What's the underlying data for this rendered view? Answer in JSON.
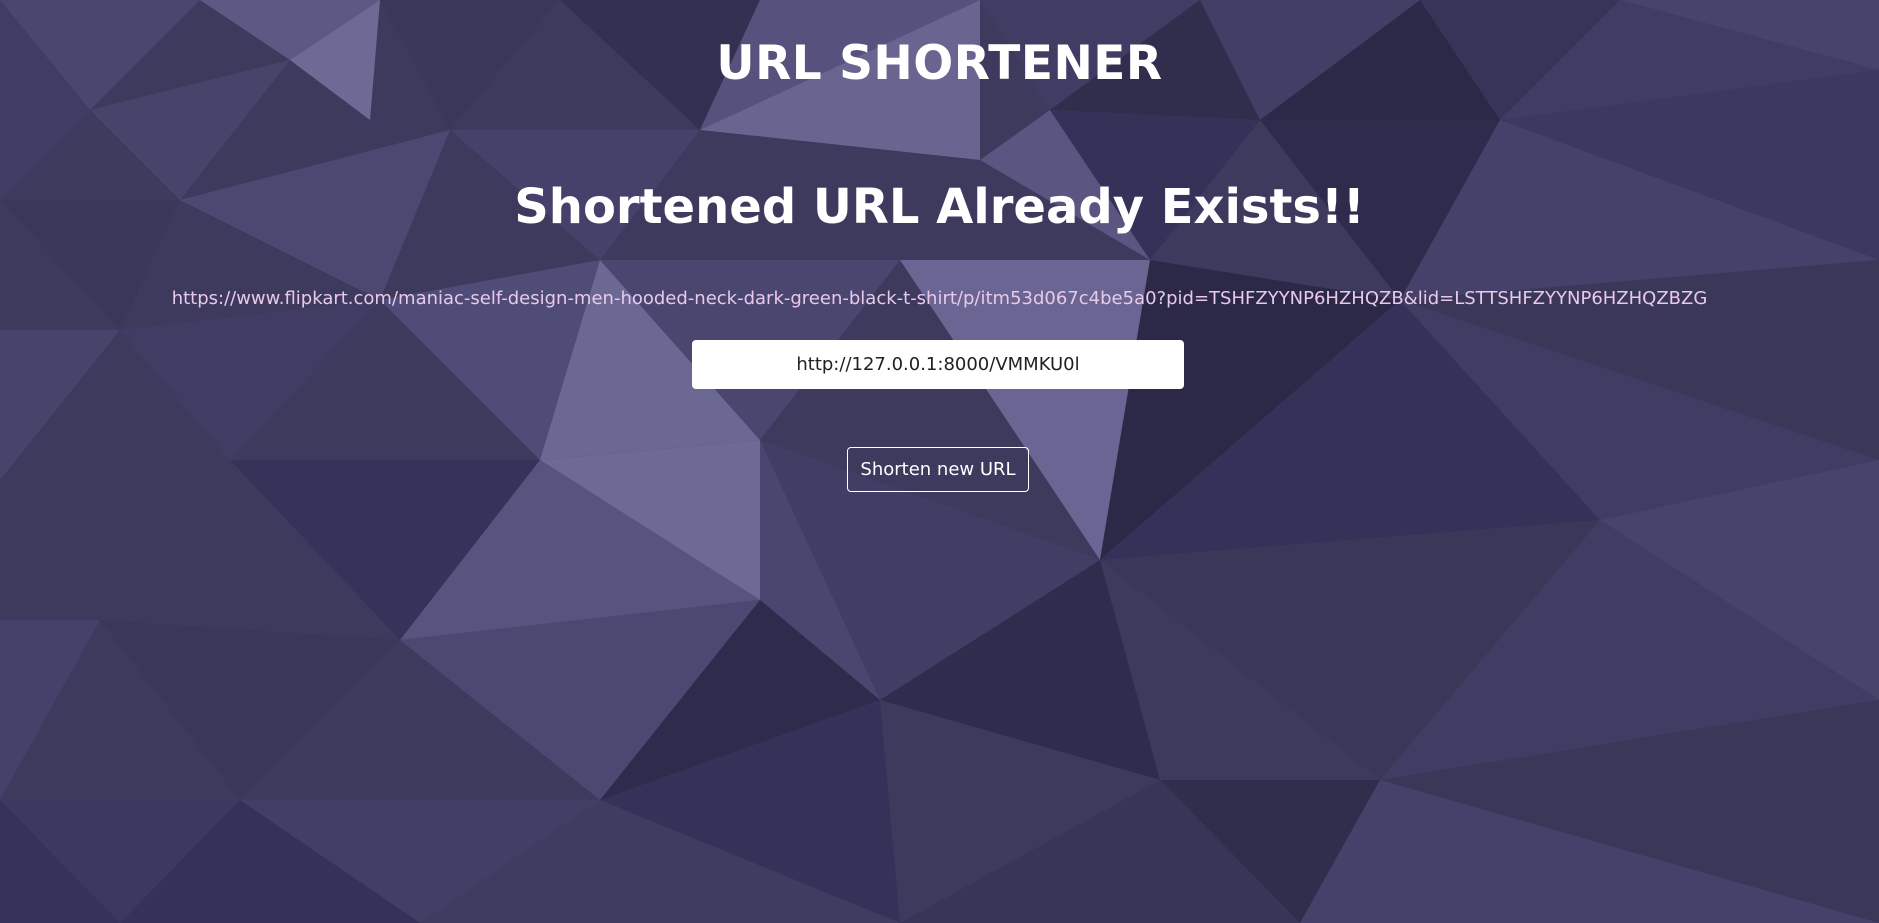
{
  "header": {
    "title": "URL SHORTENER"
  },
  "result": {
    "heading": "Shortened URL Already Exists!!",
    "original_url": "https://www.flipkart.com/maniac-self-design-men-hooded-neck-dark-green-black-t-shirt/p/itm53d067c4be5a0?pid=TSHFZYYNP6HZHQZB&lid=LSTTSHFZYYNP6HZHQZBZG",
    "short_url": "http://127.0.0.1:8000/VMMKU0l"
  },
  "actions": {
    "shorten_new_label": "Shorten new URL"
  },
  "colors": {
    "background": "#3d3a5e",
    "original_url_text": "#e9c9ea",
    "heading_text": "#ffffff"
  }
}
